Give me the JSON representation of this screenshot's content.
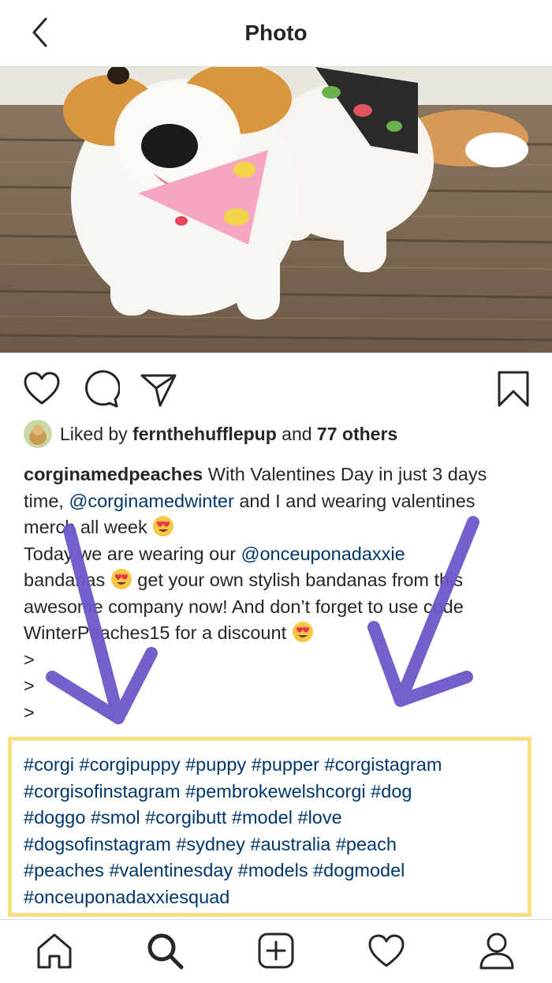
{
  "header": {
    "title": "Photo"
  },
  "post": {
    "liked_prefix": "Liked by ",
    "liked_user": "fernthehufflepup",
    "liked_and": " and ",
    "liked_others": "77 others",
    "caption": {
      "username": "corginamedpeaches",
      "l1_text": " With Valentines Day in just 3 days",
      "l2_a": "time, ",
      "l2_mention": "@corginamedwinter",
      "l2_b": " and I and wearing valentines",
      "l3_a": "merch all week ",
      "l4_a": "Today we are wearing our ",
      "l4_mention": "@onceuponadaxxie",
      "l5_a": "bandanas ",
      "l5_b": " get your own stylish bandanas from this",
      "l6": "awesome company now! And don’t forget to use code",
      "l7_a": "WinterPeaches15 for a discount ",
      "gt1": ">",
      "gt2": ">",
      "gt3": ">"
    },
    "hashtags": [
      "#corgi #corgipuppy #puppy #pupper #corgistagram",
      "#corgisofinstagram #pembrokewelshcorgi #dog",
      "#doggo #smol #corgibutt #model #love",
      "#dogsofinstagram #sydney #australia #peach",
      "#peaches #valentinesday #models #dogmodel",
      "#onceuponadaxxiesquad"
    ]
  },
  "colors": {
    "link": "#00376b",
    "highlight_box": "#f7df7f",
    "arrow": "#6f56c9",
    "text": "#262626"
  },
  "icons": {
    "back": "chevron-left-icon",
    "like": "heart-icon",
    "comment": "comment-bubble-icon",
    "share": "paper-plane-icon",
    "save": "bookmark-icon",
    "emoji": "heart-eyes-emoji",
    "tab_home": "home-icon",
    "tab_search": "search-icon",
    "tab_add": "add-post-icon",
    "tab_activity": "heart-icon",
    "tab_profile": "profile-icon"
  }
}
